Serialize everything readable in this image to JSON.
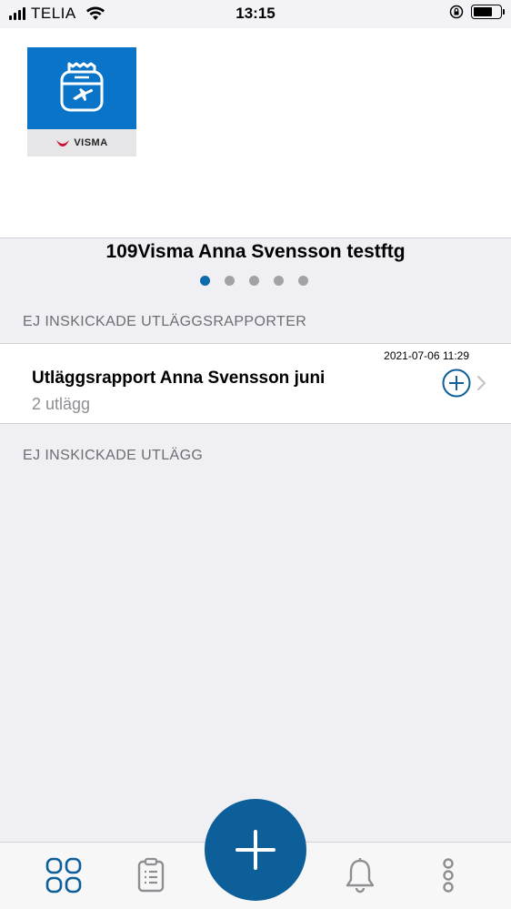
{
  "status_bar": {
    "carrier": "TELIA",
    "time": "13:15"
  },
  "header": {
    "app_logo_brand": "VISMA"
  },
  "company": {
    "name": "109Visma Anna Svensson testftg",
    "page_count": 5,
    "active_page": 1
  },
  "sections": {
    "unsent_reports_title": "EJ INSKICKADE UTLÄGGSRAPPORTER",
    "unsent_expenses_title": "EJ INSKICKADE UTLÄGG"
  },
  "reports": [
    {
      "title": "Utläggsrapport Anna Svensson juni",
      "subtitle": "2 utlägg",
      "date": "2021-07-06 11:29"
    }
  ],
  "tab_bar": {
    "icons": [
      "grid-icon",
      "clipboard-icon",
      "add-icon",
      "bell-icon",
      "more-icon"
    ]
  },
  "colors": {
    "accent": "#0d5f99",
    "logo_blue": "#0a74c9",
    "section_text": "#6d6d72",
    "background": "#efeff4"
  }
}
